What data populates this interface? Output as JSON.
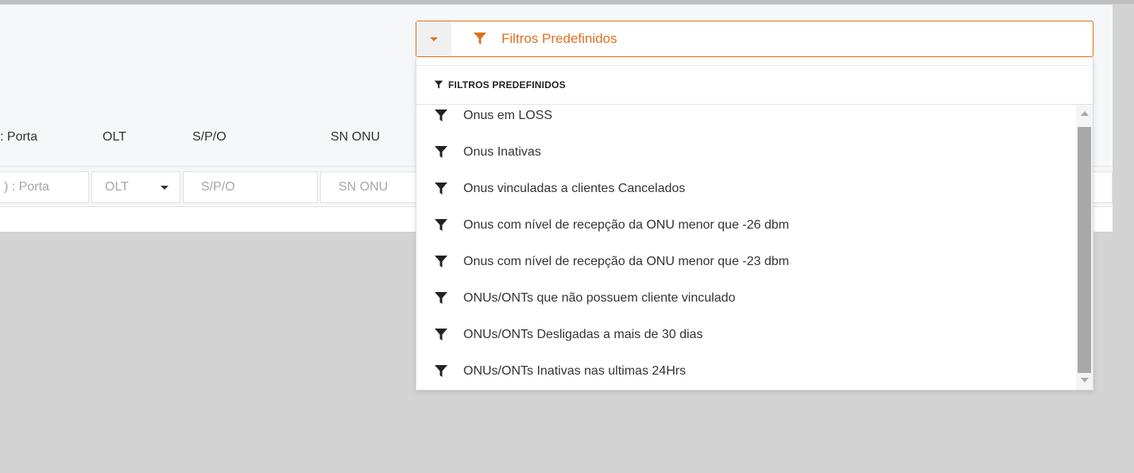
{
  "table": {
    "headers": {
      "porta": ": Porta",
      "olt": "OLT",
      "spo": "S/P/O",
      "sn_onu": "SN ONU"
    },
    "filters": {
      "porta_placeholder": ") : Porta",
      "olt_value": "OLT",
      "spo_placeholder": "S/P/O",
      "sn_onu_placeholder": "SN ONU"
    }
  },
  "predefined_filters": {
    "button_label": "Filtros Predefinidos",
    "menu_header": "FILTROS PREDEFINIDOS",
    "accent_color": "#e07020",
    "items": [
      {
        "label": "Onus em LOSS",
        "icon": "filter-icon"
      },
      {
        "label": "Onus Inativas",
        "icon": "filter-icon"
      },
      {
        "label": "Onus vinculadas a clientes Cancelados",
        "icon": "filter-icon"
      },
      {
        "label": "Onus com nível de recepção da ONU menor que -26 dbm",
        "icon": "filter-icon"
      },
      {
        "label": "Onus com nível de recepção da ONU menor que -23 dbm",
        "icon": "filter-icon"
      },
      {
        "label": "ONUs/ONTs que não possuem cliente vinculado",
        "icon": "filter-icon"
      },
      {
        "label": "ONUs/ONTs Desligadas a mais de 30 dias",
        "icon": "filter-icon"
      },
      {
        "label": "ONUs/ONTs Inativas nas ultimas 24Hrs",
        "icon": "filter-icon"
      }
    ]
  }
}
